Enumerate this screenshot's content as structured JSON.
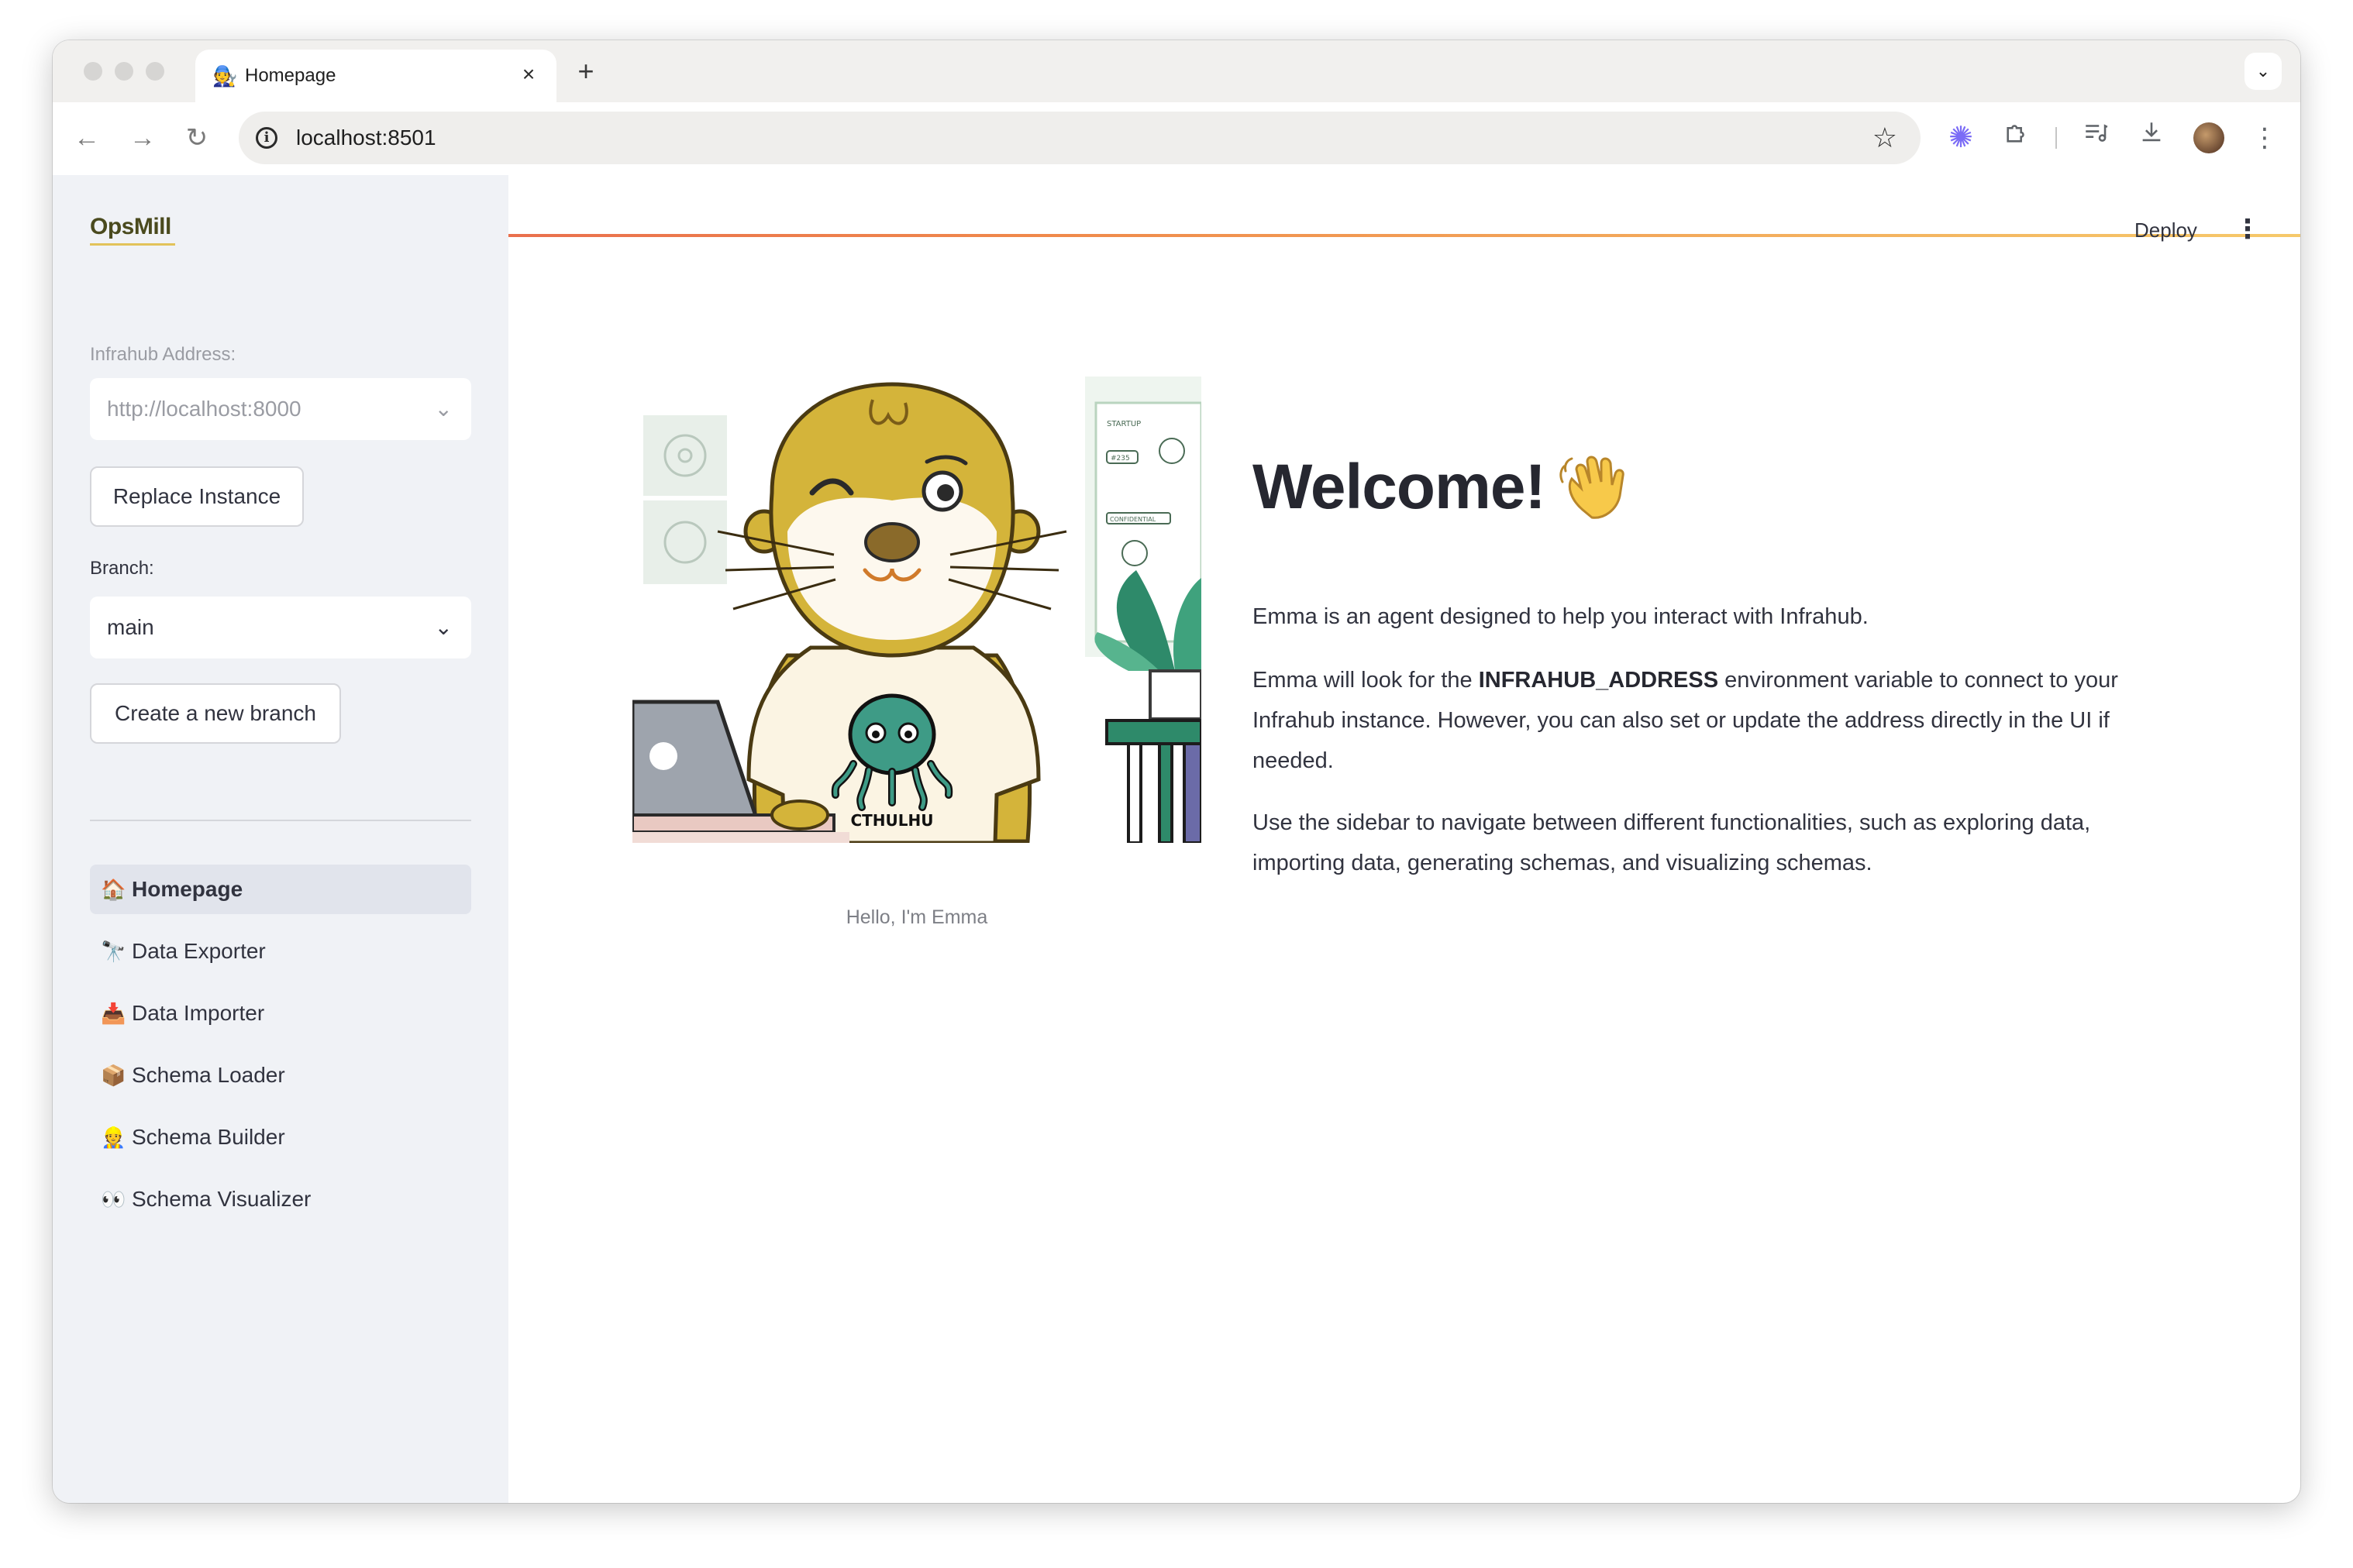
{
  "browser": {
    "tab_title": "Homepage",
    "tab_favicon": "🧑‍🔧",
    "url": "localhost:8501",
    "icons": {
      "back": "back-arrow-icon",
      "forward": "forward-arrow-icon",
      "reload": "reload-icon",
      "info": "site-info-icon",
      "star": "bookmark-star-icon",
      "extension": "extension-icon",
      "puzzle": "extensions-puzzle-icon",
      "media": "media-control-icon",
      "download": "download-icon",
      "menu": "more-vert-icon"
    }
  },
  "sidebar": {
    "logo": "OpsMill",
    "address_label": "Infrahub Address:",
    "address_value": "http://localhost:8000",
    "replace_button": "Replace Instance",
    "branch_label": "Branch:",
    "branch_value": "main",
    "create_branch_button": "Create a new branch",
    "nav": [
      {
        "emoji": "🏠",
        "label": "Homepage",
        "active": true
      },
      {
        "emoji": "🔭",
        "label": "Data Exporter"
      },
      {
        "emoji": "📥",
        "label": "Data Importer"
      },
      {
        "emoji": "📦",
        "label": "Schema Loader"
      },
      {
        "emoji": "👷",
        "label": "Schema Builder"
      },
      {
        "emoji": "👀",
        "label": "Schema Visualizer"
      }
    ]
  },
  "header": {
    "deploy": "Deploy",
    "menu_icon": "more-vert-icon"
  },
  "main": {
    "image_caption": "Hello, I'm Emma",
    "shirt_text": "CTHULHU",
    "sticky_labels": [
      "STARTUP",
      "#235",
      "CONFIDENTIAL"
    ],
    "title": "Welcome!",
    "title_emoji": "👋",
    "p1": "Emma is an agent designed to help you interact with Infrahub.",
    "p2_before": "Emma will look for the ",
    "p2_bold": "INFRAHUB_ADDRESS",
    "p2_after": " environment variable to connect to your Infrahub instance. However, you can also set or update the address directly in the UI if needed.",
    "p3": "Use the sidebar to navigate between different functionalities, such as exploring data, importing data, generating schemas, and visualizing schemas."
  },
  "colors": {
    "sidebar_bg": "#f0f2f6",
    "text": "#31333f",
    "accent_gradient_start": "#e55a4f",
    "accent_gradient_end": "#f6c96a",
    "otter_fur": "#d4b43a"
  }
}
